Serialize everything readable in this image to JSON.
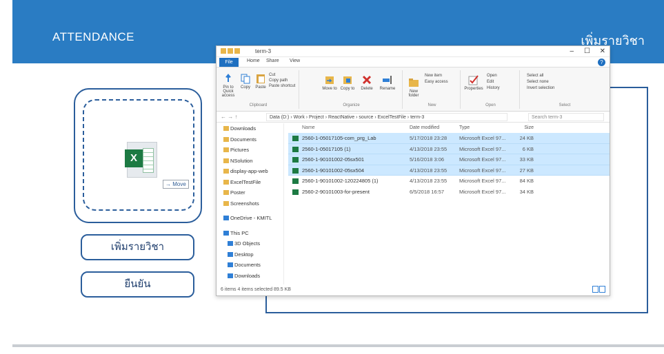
{
  "header": {
    "title": "ATTENDANCE",
    "right_title": "เพิ่มรายวิชา"
  },
  "dropzone": {
    "move_label": "→ Move"
  },
  "buttons": {
    "add_course": "เพิ่มรายวิชา",
    "confirm": "ยืนยัน"
  },
  "explorer": {
    "window_title": "term-3",
    "tabs": [
      "File",
      "Home",
      "Share",
      "View"
    ],
    "ribbon": {
      "clipboard": {
        "label": "Clipboard",
        "pin": "Pin to Quick access",
        "copy": "Copy",
        "paste": "Paste",
        "cut": "Cut",
        "copy_path": "Copy path",
        "paste_shortcut": "Paste shortcut"
      },
      "organize": {
        "label": "Organize",
        "move_to": "Move to",
        "copy_to": "Copy to",
        "delete": "Delete",
        "rename": "Rename"
      },
      "new": {
        "label": "New",
        "new_folder": "New folder",
        "new_item": "New item",
        "easy_access": "Easy access"
      },
      "open": {
        "label": "Open",
        "properties": "Properties",
        "open": "Open",
        "edit": "Edit",
        "history": "History"
      },
      "select": {
        "label": "Select",
        "select_all": "Select all",
        "select_none": "Select none",
        "invert": "Invert selection"
      }
    },
    "address": "Data (D:) › Work › Project › ReactNative › source › ExcelTestFile › term-3",
    "search_placeholder": "Search term-3",
    "nav": [
      {
        "label": "Downloads",
        "type": "folder",
        "indent": false
      },
      {
        "label": "Documents",
        "type": "folder",
        "indent": false
      },
      {
        "label": "Pictures",
        "type": "folder",
        "indent": false
      },
      {
        "label": "NSolution",
        "type": "folder",
        "indent": false
      },
      {
        "label": "display-app-web",
        "type": "folder",
        "indent": false
      },
      {
        "label": "ExcelTestFile",
        "type": "folder",
        "indent": false
      },
      {
        "label": "Poster",
        "type": "folder",
        "indent": false
      },
      {
        "label": "Screenshots",
        "type": "folder",
        "indent": false
      },
      {
        "label": "",
        "type": "spacer",
        "indent": false
      },
      {
        "label": "OneDrive - KMITL",
        "type": "blue",
        "indent": false
      },
      {
        "label": "",
        "type": "spacer",
        "indent": false
      },
      {
        "label": "This PC",
        "type": "blue",
        "indent": false
      },
      {
        "label": "3D Objects",
        "type": "blue",
        "indent": true
      },
      {
        "label": "Desktop",
        "type": "blue",
        "indent": true
      },
      {
        "label": "Documents",
        "type": "blue",
        "indent": true
      },
      {
        "label": "Downloads",
        "type": "blue",
        "indent": true
      }
    ],
    "columns": {
      "name": "Name",
      "date": "Date modified",
      "type": "Type",
      "size": "Size"
    },
    "files": [
      {
        "name": "2560-1-05017105-com_prg_Lab",
        "date": "5/17/2018 23:28",
        "type": "Microsoft Excel 97...",
        "size": "24 KB",
        "selected": true
      },
      {
        "name": "2560-1-05017105 (1)",
        "date": "4/13/2018 23:55",
        "type": "Microsoft Excel 97...",
        "size": "6 KB",
        "selected": true
      },
      {
        "name": "2560-1-90101002-05sx501",
        "date": "5/16/2018 3:06",
        "type": "Microsoft Excel 97...",
        "size": "33 KB",
        "selected": true
      },
      {
        "name": "2560-1-90101002-05sx504",
        "date": "4/13/2018 23:55",
        "type": "Microsoft Excel 97...",
        "size": "27 KB",
        "selected": true
      },
      {
        "name": "2560-1-90101002-120224805 (1)",
        "date": "4/13/2018 23:55",
        "type": "Microsoft Excel 97...",
        "size": "84 KB",
        "selected": false
      },
      {
        "name": "2560-2-90101003-for-present",
        "date": "6/5/2018 16:57",
        "type": "Microsoft Excel 97...",
        "size": "34 KB",
        "selected": false
      }
    ],
    "status": "6 items    4 items selected  89.5 KB"
  }
}
